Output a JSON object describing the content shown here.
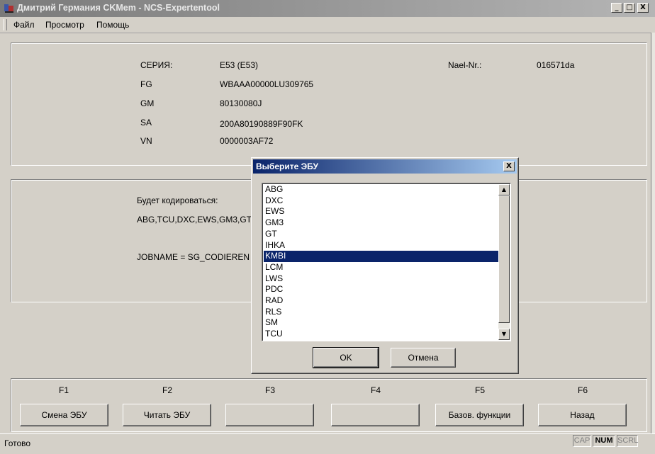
{
  "window": {
    "title": "Дмитрий Германия CKMem - NCS-Expertentool",
    "controls": {
      "minimize": "_",
      "maximize": "□",
      "close": "X"
    }
  },
  "menu": {
    "items": [
      "Файл",
      "Просмотр",
      "Помощь"
    ]
  },
  "vehicle": {
    "labels": {
      "series": "СЕРИЯ:",
      "fg": "FG",
      "gm": "GM",
      "sa": "SA",
      "vn": "VN",
      "nael": "Nael-Nr.:"
    },
    "values": {
      "series": "E53 (E53)",
      "fg": "WBAAA00000LU309765",
      "gm": "80130080J",
      "sa": "200A80190889F90FK",
      "vn": "0000003AF72",
      "nael": "016571da"
    }
  },
  "coding": {
    "heading": "Будет кодироваться:",
    "list": "ABG,TCU,DXC,EWS,GM3,GT,IH",
    "jobname": "JOBNAME = SG_CODIEREN"
  },
  "function_keys": [
    {
      "key": "F1",
      "label": "Смена ЭБУ"
    },
    {
      "key": "F2",
      "label": "Читать ЭБУ"
    },
    {
      "key": "F3",
      "label": ""
    },
    {
      "key": "F4",
      "label": ""
    },
    {
      "key": "F5",
      "label": "Базов. функции"
    },
    {
      "key": "F6",
      "label": "Назад"
    }
  ],
  "status": {
    "text": "Готово",
    "indicators": [
      "CAP",
      "NUM",
      "SCRL"
    ]
  },
  "dialog": {
    "title": "Выберите ЭБУ",
    "close": "X",
    "items": [
      "ABG",
      "DXC",
      "EWS",
      "GM3",
      "GT",
      "IHKA",
      "KMBI",
      "LCM",
      "LWS",
      "PDC",
      "RAD",
      "RLS",
      "SM",
      "TCU"
    ],
    "selected": "KMBI",
    "ok_label": "OK",
    "cancel_label": "Отмена"
  },
  "icons": {
    "app": "app-icon",
    "scroll_up": "scroll-up-arrow-icon",
    "scroll_down": "scroll-down-arrow-icon"
  },
  "colors": {
    "selection": "#0a246a",
    "dialog_title": "#0a246a",
    "face": "#d4d0c8"
  }
}
